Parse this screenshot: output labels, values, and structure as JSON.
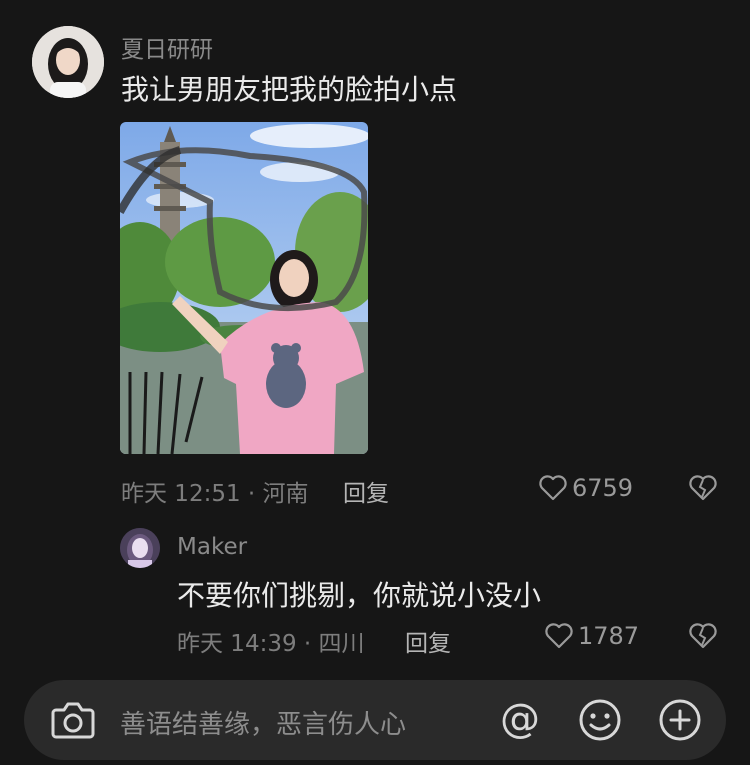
{
  "comments": [
    {
      "username": "夏日研研",
      "text": "我让男朋友把我的脸拍小点",
      "meta": "昨天 12:51 · 河南",
      "reply_label": "回复",
      "likes": "6759"
    },
    {
      "username": "Maker",
      "text": "不要你们挑剔，你就说小没小",
      "meta": "昨天 14:39 · 四川",
      "reply_label": "回复",
      "likes": "1787"
    }
  ],
  "input": {
    "placeholder": "善语结善缘，恶言伤人心"
  },
  "icons": {
    "camera": "camera-icon",
    "mention": "at-icon",
    "emoji": "emoji-icon",
    "add": "plus-icon",
    "like": "heart-icon",
    "dislike": "broken-heart-icon"
  },
  "colors": {
    "background": "#161616",
    "input_bar": "#2a2a2a",
    "text_primary": "#eaeaea",
    "text_secondary": "#7d7d7d"
  }
}
